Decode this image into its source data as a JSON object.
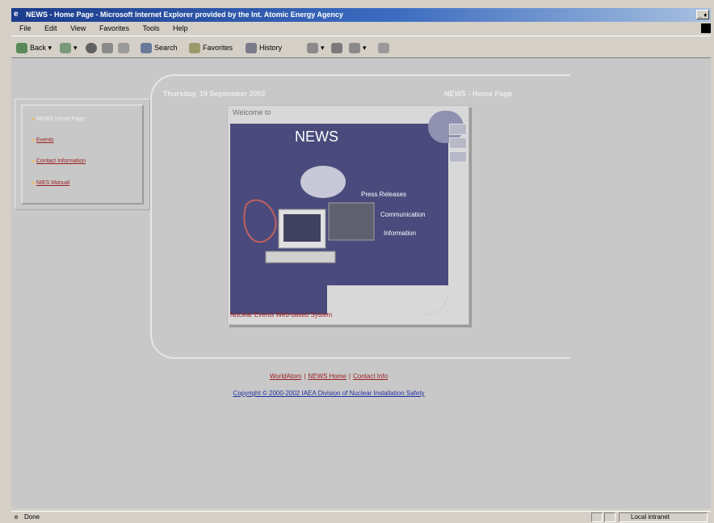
{
  "window": {
    "title": "NEWS - Home Page - Microsoft Internet Explorer provided by the Int. Atomic Energy Agency",
    "controls": "_ ♦"
  },
  "menu": [
    "File",
    "Edit",
    "View",
    "Favorites",
    "Tools",
    "Help"
  ],
  "toolbar": {
    "back": "Back",
    "search": "Search",
    "favorites": "Favorites",
    "history": "History"
  },
  "sidebar": {
    "items": [
      {
        "label": "NEWS Home Page",
        "current": true
      },
      {
        "label": "Events",
        "current": false
      },
      {
        "label": "Contact Information",
        "current": false
      },
      {
        "label": "NIES Manual",
        "current": false
      }
    ]
  },
  "header": {
    "date": "Thursday, 19 September 2002",
    "title": "NEWS - Home Page"
  },
  "banner": {
    "welcome": "Welcome to",
    "name": "NEWS",
    "menu": [
      "Press Releases",
      "Communication",
      "Information"
    ],
    "tagline": "Nuclear Events Web-based System"
  },
  "footer": {
    "links": [
      "WorldAtom",
      "NEWS Home",
      "Contact Info"
    ],
    "copyright": "Copyright © 2000-2002 IAEA Division of Nuclear Installation Safety"
  },
  "status": {
    "left": "Done",
    "zone": "Local intranet"
  },
  "colors": {
    "titlebar": "#1c3c8c",
    "banner_bg": "#4a4a7c",
    "link": "#9c2020",
    "copyright_link": "#2030a0"
  }
}
